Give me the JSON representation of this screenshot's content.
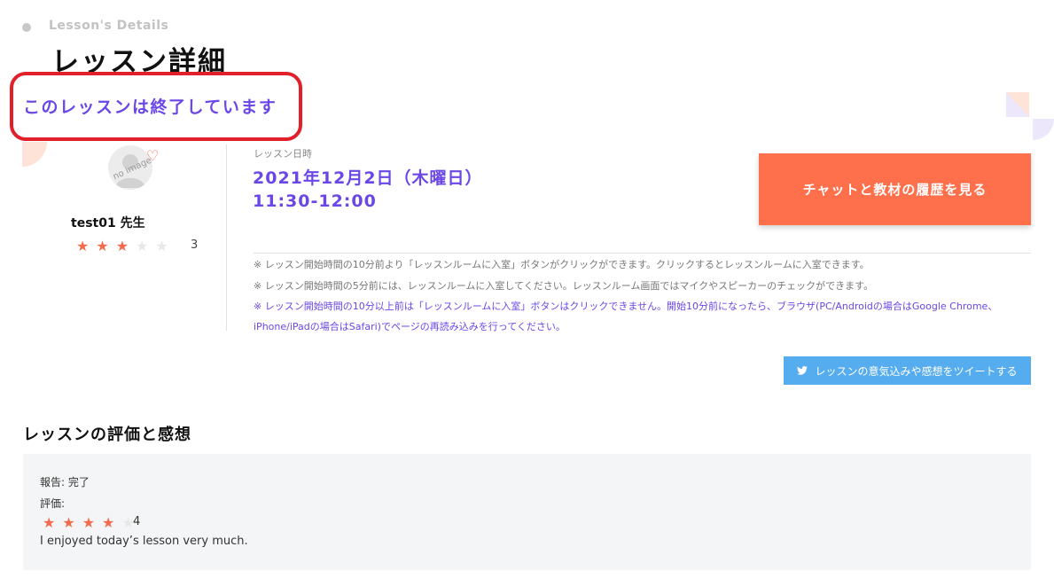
{
  "header": {
    "eyebrow": "Lesson's Details",
    "title": "レッスン詳細"
  },
  "status": {
    "text": "このレッスンは終了しています",
    "highlight_color": "#e0202a"
  },
  "teacher": {
    "avatar_text": "no image",
    "name": "test01 先生",
    "rating": 3,
    "rating_text": "3"
  },
  "lesson": {
    "date_label": "レッスン日時",
    "date": "2021年12月2日（木曜日）",
    "time": "11:30-12:00"
  },
  "actions": {
    "chat_button": "チャットと教材の履歴を見る",
    "tweet_button": "レッスンの意気込みや感想をツイートする"
  },
  "notes": [
    "※ レッスン開始時間の10分前より「レッスンルームに入室」ボタンがクリックができます。クリックするとレッスンルームに入室できます。",
    "※ レッスン開始時間の5分前には、レッスンルームに入室してください。レッスンルーム画面ではマイクやスピーカーのチェックができます。",
    "※ レッスン開始時間の10分以上前は「レッスンルームに入室」ボタンはクリックできません。開始10分前になったら、ブラウザ(PC/Androidの場合はGoogle Chrome、iPhone/iPadの場合はSafari)でページの再読み込みを行ってください。"
  ],
  "review": {
    "section_title": "レッスンの評価と感想",
    "report": "報告: 完了",
    "rating_label": "評価:",
    "rating": 4,
    "rating_text": "4",
    "comment": "I enjoyed today’s lesson very much."
  },
  "colors": {
    "accent_purple": "#6a47e6",
    "button_orange": "#fe6f4b",
    "twitter_blue": "#55acee",
    "star_on": "#f46a4c"
  },
  "icons": {
    "heart": "heart-icon",
    "twitter": "twitter-icon",
    "star": "star-icon"
  }
}
